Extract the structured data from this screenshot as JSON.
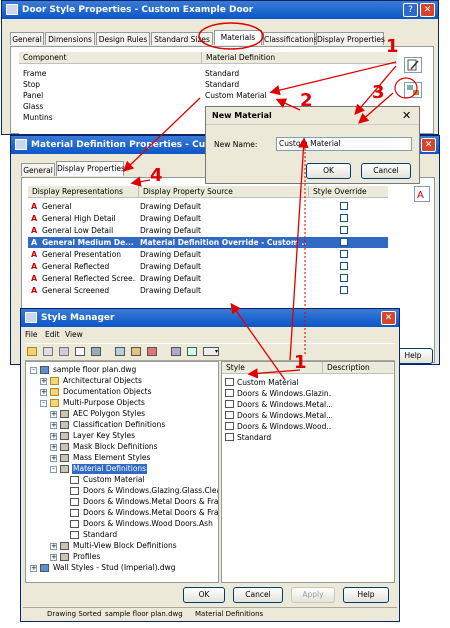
{
  "door_window": {
    "title": "Door Style Properties - Custom Example Door",
    "tabs": [
      "General",
      "Dimensions",
      "Design Rules",
      "Standard Sizes",
      "Materials",
      "Classifications",
      "Display Properties"
    ],
    "active_tab": "Materials",
    "col_component": "Component",
    "col_material": "Material Definition",
    "rows": [
      {
        "component": "Frame",
        "material": "Standard"
      },
      {
        "component": "Stop",
        "material": "Standard"
      },
      {
        "component": "Panel",
        "material": "Custom Material"
      },
      {
        "component": "Glass",
        "material": ""
      },
      {
        "component": "Muntins",
        "material": ""
      }
    ]
  },
  "mat_window": {
    "title": "Material Definition Properties - Custom",
    "tabs": [
      "General",
      "Display Properties"
    ],
    "active_tab": "Display Properties",
    "col_rep": "Display Representations",
    "col_source": "Display Property Source",
    "col_override": "Style Override",
    "rows": [
      {
        "rep": "General",
        "source": "Drawing Default",
        "override": false
      },
      {
        "rep": "General High Detail",
        "source": "Drawing Default",
        "override": false
      },
      {
        "rep": "General Low Detail",
        "source": "Drawing Default",
        "override": false
      },
      {
        "rep": "General Medium De...",
        "source": "Material Definition Override - Custom ...",
        "override": true
      },
      {
        "rep": "General Presentation",
        "source": "Drawing Default",
        "override": false
      },
      {
        "rep": "General Reflected",
        "source": "Drawing Default",
        "override": false
      },
      {
        "rep": "General Reflected Scree...",
        "source": "Drawing Default",
        "override": false
      },
      {
        "rep": "General Screened",
        "source": "Drawing Default",
        "override": false
      }
    ],
    "help_label": "Help"
  },
  "new_material": {
    "title": "New Material",
    "name_label": "New Name:",
    "name_value": "Custom Material",
    "ok_label": "OK",
    "cancel_label": "Cancel"
  },
  "style_manager": {
    "title": "Style Manager",
    "menus": [
      "File",
      "Edit",
      "View"
    ],
    "tree": [
      {
        "label": "sample floor plan.dwg",
        "level": 0,
        "pm": "-"
      },
      {
        "label": "Architectural Objects",
        "level": 1,
        "pm": "+"
      },
      {
        "label": "Documentation Objects",
        "level": 1,
        "pm": "+"
      },
      {
        "label": "Multi-Purpose Objects",
        "level": 1,
        "pm": "-"
      },
      {
        "label": "AEC Polygon Styles",
        "level": 2,
        "pm": "+"
      },
      {
        "label": "Classification Definitions",
        "level": 2,
        "pm": "+"
      },
      {
        "label": "Layer Key Styles",
        "level": 2,
        "pm": "+"
      },
      {
        "label": "Mask Block Definitions",
        "level": 2,
        "pm": "+"
      },
      {
        "label": "Mass Element Styles",
        "level": 2,
        "pm": "+"
      },
      {
        "label": "Material Definitions",
        "level": 2,
        "pm": "-",
        "selected": true
      },
      {
        "label": "Custom Material",
        "level": 3,
        "pm": ""
      },
      {
        "label": "Doors & Windows.Glazing.Glass.Clear",
        "level": 3,
        "pm": ""
      },
      {
        "label": "Doors & Windows.Metal Doors & Fram",
        "level": 3,
        "pm": ""
      },
      {
        "label": "Doors & Windows.Metal Doors & Fram",
        "level": 3,
        "pm": ""
      },
      {
        "label": "Doors & Windows.Wood Doors.Ash",
        "level": 3,
        "pm": ""
      },
      {
        "label": "Standard",
        "level": 3,
        "pm": ""
      },
      {
        "label": "Multi-View Block Definitions",
        "level": 2,
        "pm": "+"
      },
      {
        "label": "Profiles",
        "level": 2,
        "pm": "+"
      },
      {
        "label": "Wall Styles - Stud (Imperial).dwg",
        "level": 0,
        "pm": "+"
      }
    ],
    "col_style": "Style",
    "col_desc": "Description",
    "styles": [
      "Custom Material",
      "Doors & Windows.Glazin...",
      "Doors & Windows.Metal...",
      "Doors & Windows.Metal...",
      "Doors & Windows.Wood...",
      "Standard"
    ],
    "ok_label": "OK",
    "cancel_label": "Cancel",
    "apply_label": "Apply",
    "help_label": "Help",
    "status": [
      "Drawing Sorted",
      "sample floor plan.dwg",
      "Material Definitions"
    ]
  },
  "annotations": [
    "1",
    "2",
    "3",
    "4",
    "1"
  ]
}
